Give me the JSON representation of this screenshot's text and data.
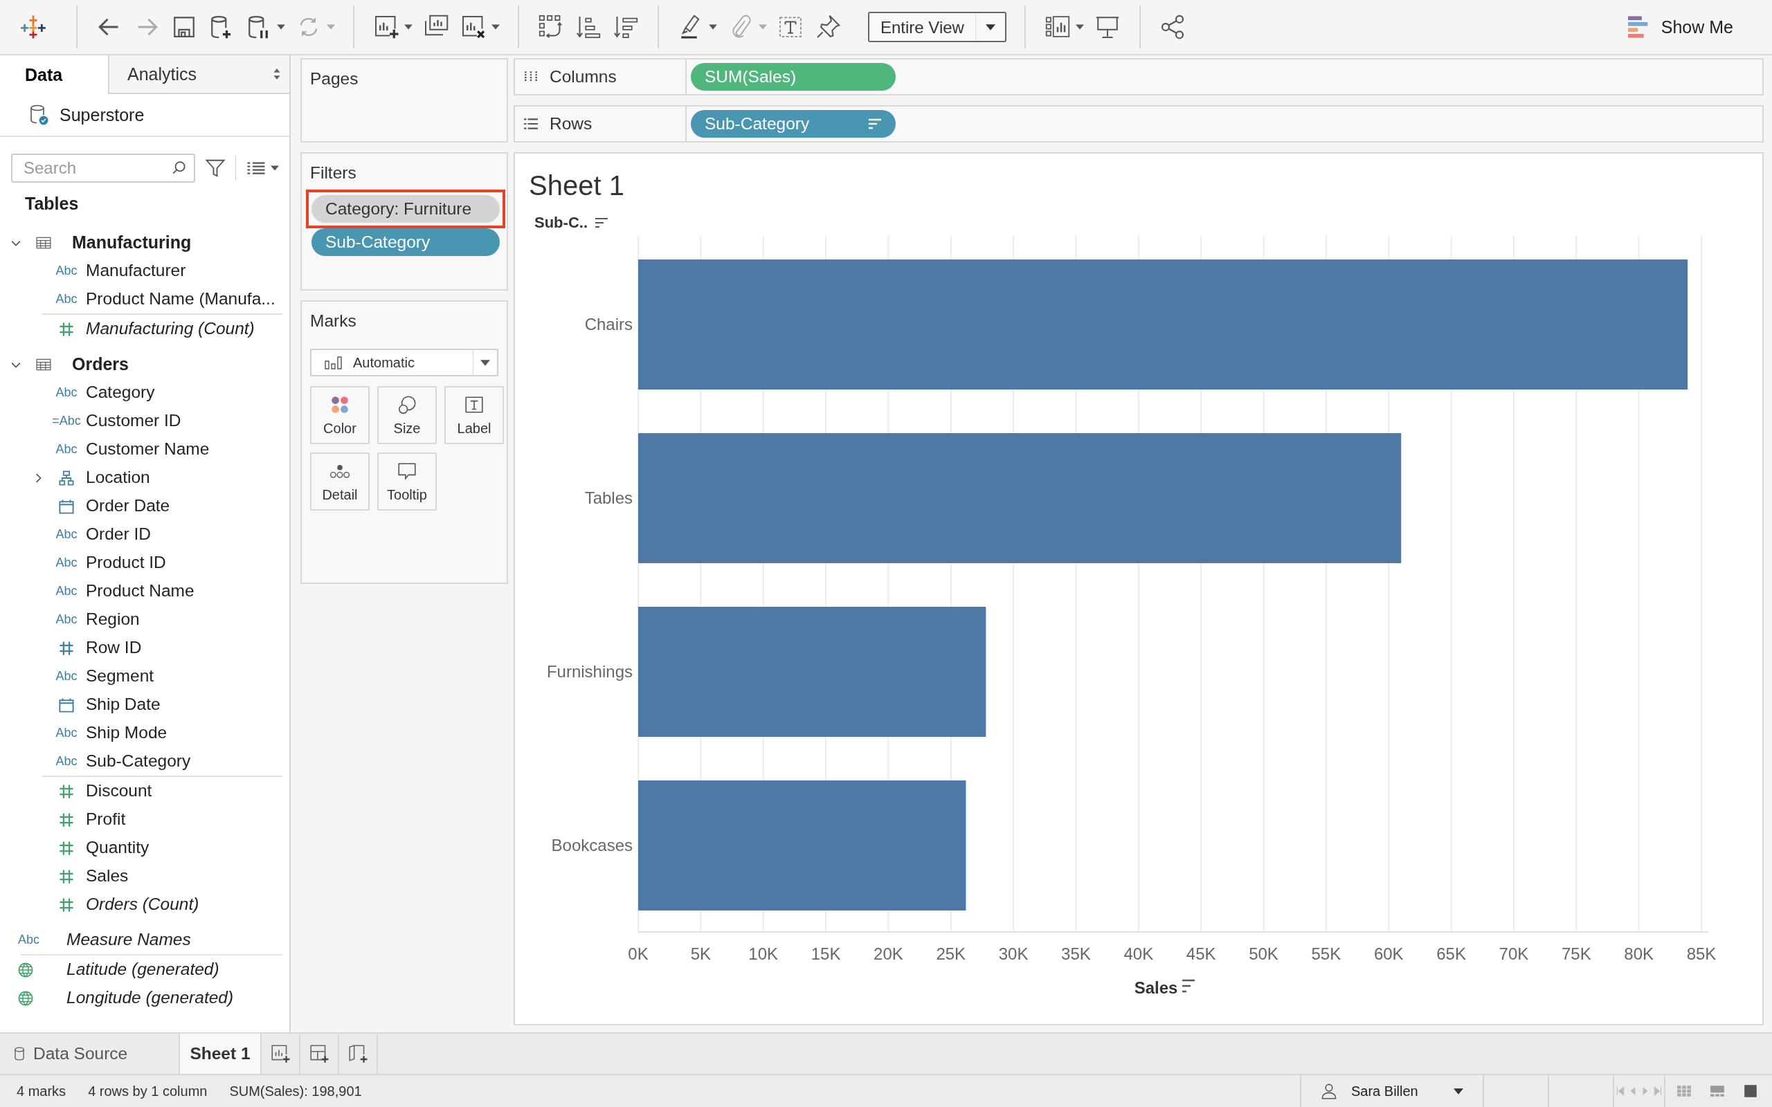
{
  "toolbar": {
    "view_mode": "Entire View",
    "show_me": "Show Me"
  },
  "data_pane": {
    "tabs": [
      {
        "label": "Data",
        "selected": true
      },
      {
        "label": "Analytics",
        "selected": false
      }
    ],
    "source": "Superstore",
    "search": {
      "placeholder": "Search"
    },
    "section_title": "Tables",
    "tables": [
      {
        "name": "Manufacturing",
        "expanded": true,
        "fields": [
          {
            "kind": "text",
            "icon_text": "Abc",
            "name": "Manufacturer",
            "color": "#3e7ea5",
            "italic": false
          },
          {
            "kind": "text",
            "icon_text": "Abc",
            "name": "Product Name (Manufa...",
            "color": "#3e7ea5",
            "italic": false
          },
          {
            "kind": "number",
            "name": "Manufacturing (Count)",
            "color": "#3fa46a",
            "italic": true
          }
        ]
      },
      {
        "name": "Orders",
        "expanded": true,
        "fields": [
          {
            "kind": "text",
            "icon_text": "Abc",
            "name": "Category",
            "color": "#3e7ea5",
            "italic": false
          },
          {
            "kind": "text",
            "icon_text": "=Abc",
            "name": "Customer ID",
            "color": "#3e7ea5",
            "italic": false
          },
          {
            "kind": "text",
            "icon_text": "Abc",
            "name": "Customer Name",
            "color": "#3e7ea5",
            "italic": false
          },
          {
            "kind": "hierarchy",
            "name": "Location",
            "color": "#3e7ea5",
            "italic": false,
            "expanded": false
          },
          {
            "kind": "date",
            "name": "Order Date",
            "color": "#3e7ea5",
            "italic": false
          },
          {
            "kind": "text",
            "icon_text": "Abc",
            "name": "Order ID",
            "color": "#3e7ea5",
            "italic": false
          },
          {
            "kind": "text",
            "icon_text": "Abc",
            "name": "Product ID",
            "color": "#3e7ea5",
            "italic": false
          },
          {
            "kind": "text",
            "icon_text": "Abc",
            "name": "Product Name",
            "color": "#3e7ea5",
            "italic": false
          },
          {
            "kind": "text",
            "icon_text": "Abc",
            "name": "Region",
            "color": "#3e7ea5",
            "italic": false
          },
          {
            "kind": "number",
            "name": "Row ID",
            "color": "#3e7ea5",
            "italic": false
          },
          {
            "kind": "text",
            "icon_text": "Abc",
            "name": "Segment",
            "color": "#3e7ea5",
            "italic": false
          },
          {
            "kind": "date",
            "name": "Ship Date",
            "color": "#3e7ea5",
            "italic": false
          },
          {
            "kind": "text",
            "icon_text": "Abc",
            "name": "Ship Mode",
            "color": "#3e7ea5",
            "italic": false
          },
          {
            "kind": "text",
            "icon_text": "Abc",
            "name": "Sub-Category",
            "color": "#3e7ea5",
            "italic": false
          },
          {
            "kind": "number",
            "name": "Discount",
            "color": "#3fa46a",
            "italic": false
          },
          {
            "kind": "number",
            "name": "Profit",
            "color": "#3fa46a",
            "italic": false
          },
          {
            "kind": "number",
            "name": "Quantity",
            "color": "#3fa46a",
            "italic": false
          },
          {
            "kind": "number",
            "name": "Sales",
            "color": "#3fa46a",
            "italic": false
          },
          {
            "kind": "number",
            "name": "Orders (Count)",
            "color": "#3fa46a",
            "italic": true
          }
        ]
      }
    ],
    "extra_fields": [
      {
        "kind": "text",
        "icon_text": "Abc",
        "name": "Measure Names",
        "color": "#3e7ea5",
        "italic": true
      },
      {
        "kind": "geo",
        "name": "Latitude (generated)",
        "color": "#3fa46a",
        "italic": true
      },
      {
        "kind": "geo",
        "name": "Longitude (generated)",
        "color": "#3fa46a",
        "italic": true
      }
    ]
  },
  "pages": {
    "title": "Pages"
  },
  "filters": {
    "title": "Filters",
    "pills": [
      {
        "label": "Category: Furniture",
        "color": "#d4d4d4",
        "highlighted": true
      },
      {
        "label": "Sub-Category",
        "color": "#4996b2",
        "highlighted": false
      }
    ]
  },
  "marks": {
    "title": "Marks",
    "mark_type": "Automatic",
    "cards": [
      {
        "kind": "color",
        "label": "Color"
      },
      {
        "kind": "size",
        "label": "Size"
      },
      {
        "kind": "label",
        "label": "Label"
      },
      {
        "kind": "detail",
        "label": "Detail"
      },
      {
        "kind": "tooltip",
        "label": "Tooltip"
      }
    ]
  },
  "shelves": [
    {
      "kind": "columns",
      "label": "Columns",
      "pill": {
        "label": "SUM(Sales)",
        "color": "#4fb67c",
        "sorted": false
      }
    },
    {
      "kind": "rows",
      "label": "Rows",
      "pill": {
        "label": "Sub-Category",
        "color": "#4996b2",
        "sorted": true
      }
    }
  ],
  "sheet": {
    "title": "Sheet 1",
    "row_header": "Sub-C..",
    "chart_data": {
      "type": "bar",
      "orientation": "horizontal",
      "xlabel": "Sales",
      "grid": true,
      "categories": [
        "Chairs",
        "Tables",
        "Furnishings",
        "Bookcases"
      ],
      "series": [
        {
          "color": "#4e79a7",
          "values": [
            83900,
            61000,
            27800,
            26200
          ]
        }
      ],
      "xlim": [
        0,
        85000
      ],
      "xticks": [
        {
          "value": 0,
          "label": "0K"
        },
        {
          "value": 5000,
          "label": "5K"
        },
        {
          "value": 10000,
          "label": "10K"
        },
        {
          "value": 15000,
          "label": "15K"
        },
        {
          "value": 20000,
          "label": "20K"
        },
        {
          "value": 25000,
          "label": "25K"
        },
        {
          "value": 30000,
          "label": "30K"
        },
        {
          "value": 35000,
          "label": "35K"
        },
        {
          "value": 40000,
          "label": "40K"
        },
        {
          "value": 45000,
          "label": "45K"
        },
        {
          "value": 50000,
          "label": "50K"
        },
        {
          "value": 55000,
          "label": "55K"
        },
        {
          "value": 60000,
          "label": "60K"
        },
        {
          "value": 65000,
          "label": "65K"
        },
        {
          "value": 70000,
          "label": "70K"
        },
        {
          "value": 75000,
          "label": "75K"
        },
        {
          "value": 80000,
          "label": "80K"
        },
        {
          "value": 85000,
          "label": "85K"
        }
      ]
    }
  },
  "sheet_tabs": [
    {
      "label": "Data Source",
      "kind": "datasource",
      "selected": false
    },
    {
      "label": "Sheet 1",
      "kind": "sheet",
      "selected": true
    }
  ],
  "status_bar": {
    "marks": "4 marks",
    "shape": "4 rows by 1 column",
    "sum": "SUM(Sales): 198,901",
    "user": "Sara Billen"
  }
}
